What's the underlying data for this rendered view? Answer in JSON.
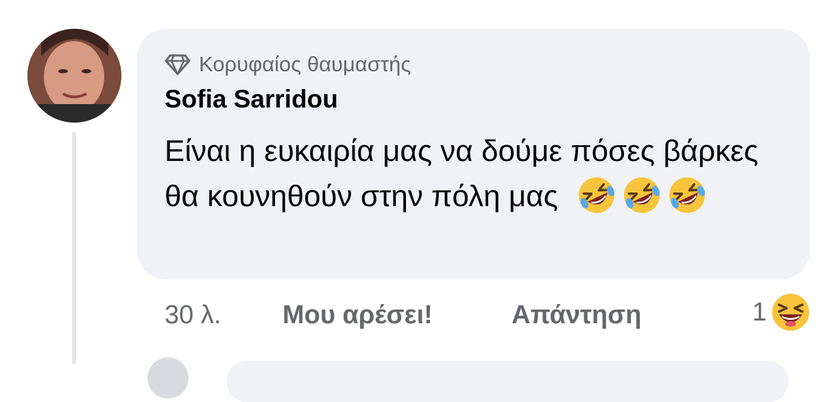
{
  "comment": {
    "badge_label": "Κορυφαίος θαυμαστής",
    "author": "Sofia Sarridou",
    "text": "Είναι η ευκαιρία μας να δούμε πόσες βάρκες θα κουνηθούν στην πόλη μας",
    "inline_emojis": [
      "rolling-on-floor-laughing",
      "rolling-on-floor-laughing",
      "rolling-on-floor-laughing"
    ],
    "timestamp": "30 λ.",
    "like_label": "Μου αρέσει!",
    "reply_label": "Απάντηση",
    "reaction_count": "1",
    "reaction_emoji": "grinning-squinting-face"
  },
  "icons": {
    "badge_icon": "diamond-icon"
  },
  "colors": {
    "bubble_bg": "#f0f2f5",
    "secondary_text": "#65676b",
    "primary_text": "#050505",
    "thread_line": "#e4e6eb"
  }
}
